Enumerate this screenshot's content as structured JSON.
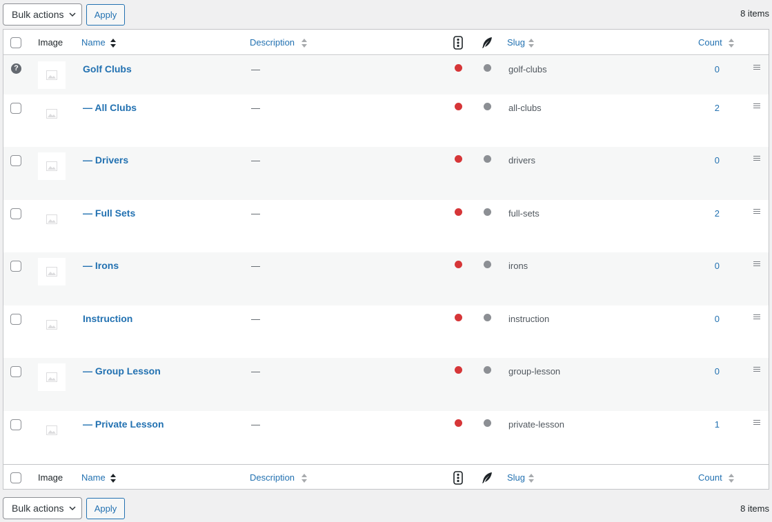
{
  "toolbar_top": {
    "bulk_label": "Bulk actions",
    "apply_label": "Apply",
    "items_count": "8 items"
  },
  "toolbar_bottom": {
    "bulk_label": "Bulk actions",
    "apply_label": "Apply",
    "items_count": "8 items"
  },
  "columns": {
    "image": "Image",
    "name": "Name",
    "description": "Description",
    "slug": "Slug",
    "count": "Count",
    "status_icon": "traffic-light-icon",
    "feather_icon": "feather-icon"
  },
  "colors": {
    "link": "#2271b1",
    "status_red": "#d63638",
    "status_grey": "#8c8f94"
  },
  "rows": [
    {
      "name": "Golf Clubs",
      "description": "—",
      "slug": "golf-clubs",
      "count": "0",
      "default": true
    },
    {
      "name": "— All Clubs",
      "description": "—",
      "slug": "all-clubs",
      "count": "2"
    },
    {
      "name": "— Drivers",
      "description": "—",
      "slug": "drivers",
      "count": "0"
    },
    {
      "name": "— Full Sets",
      "description": "—",
      "slug": "full-sets",
      "count": "2"
    },
    {
      "name": "— Irons",
      "description": "—",
      "slug": "irons",
      "count": "0"
    },
    {
      "name": "Instruction",
      "description": "—",
      "slug": "instruction",
      "count": "0"
    },
    {
      "name": "— Group Lesson",
      "description": "—",
      "slug": "group-lesson",
      "count": "0"
    },
    {
      "name": "— Private Lesson",
      "description": "—",
      "slug": "private-lesson",
      "count": "1"
    }
  ]
}
